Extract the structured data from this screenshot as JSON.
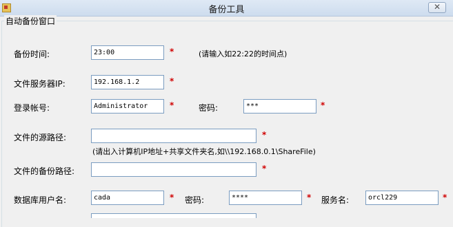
{
  "window": {
    "title": "备份工具",
    "close_glyph": "✕"
  },
  "group": {
    "title": "自动备份窗口"
  },
  "backup_time": {
    "label": "备份时间:",
    "value": "23:00",
    "hint": "(请输入如22:22的时间点)"
  },
  "file_server_ip": {
    "label": "文件服务器IP:",
    "value": "192.168.1.2"
  },
  "login_account": {
    "label": "登录帐号:",
    "value": "Administrator"
  },
  "login_password": {
    "label": "密码:",
    "value": "***"
  },
  "source_path": {
    "label": "文件的源路径:",
    "value": "",
    "hint": "(请出入计算机IP地址+共享文件夹名,如\\\\192.168.0.1\\ShareFile)"
  },
  "backup_path": {
    "label": "文件的备份路径:",
    "value": ""
  },
  "db_user": {
    "label": "数据库用户名:",
    "value": "cada"
  },
  "db_password": {
    "label": "密码:",
    "value": "****"
  },
  "service_name": {
    "label": "服务名:",
    "value": "orcl229"
  },
  "required_mark": "*"
}
